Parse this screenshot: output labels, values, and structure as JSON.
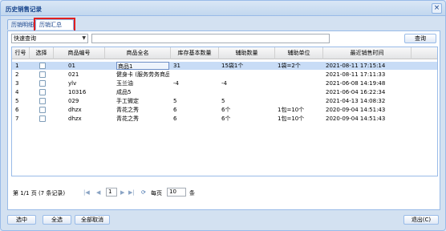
{
  "window": {
    "title": "历史销售记录",
    "close_icon": "close-icon"
  },
  "tabs": [
    {
      "label": "历销明细",
      "active": false
    },
    {
      "label": "历销汇总",
      "active": true
    }
  ],
  "search": {
    "mode": "快速查询",
    "value": "",
    "button": "查询"
  },
  "grid": {
    "columns": [
      "行号",
      "选择",
      "商品编号",
      "商品全名",
      "库存基本数量",
      "辅助数量",
      "辅助单位",
      "最近销售时间"
    ],
    "rows": [
      {
        "no": "1",
        "code": "01",
        "name": "商品1",
        "stock": "31",
        "aux_qty": "15袋1个",
        "aux_unit": "1袋=2个",
        "time": "2021-08-11 17:15:14",
        "selected": true
      },
      {
        "no": "2",
        "code": "021",
        "name": "健身卡 (服务劳务商品)",
        "stock": "",
        "aux_qty": "",
        "aux_unit": "",
        "time": "2021-08-11 17:11:33",
        "selected": false
      },
      {
        "no": "3",
        "code": "ylv",
        "name": "玉兰油",
        "stock": "-4",
        "aux_qty": "-4",
        "aux_unit": "",
        "time": "2021-06-08 14:19:48",
        "selected": false
      },
      {
        "no": "4",
        "code": "10316",
        "name": "成品5",
        "stock": "",
        "aux_qty": "",
        "aux_unit": "",
        "time": "2021-06-04 16:22:34",
        "selected": false
      },
      {
        "no": "5",
        "code": "029",
        "name": "手工微定",
        "stock": "5",
        "aux_qty": "5",
        "aux_unit": "",
        "time": "2021-04-13 14:08:32",
        "selected": false
      },
      {
        "no": "6",
        "code": "dhzx",
        "name": "青花之秀",
        "stock": "6",
        "aux_qty": "6个",
        "aux_unit": "1包=10个",
        "time": "2020-09-04 14:51:43",
        "selected": false
      },
      {
        "no": "7",
        "code": "dhzx",
        "name": "青花之秀",
        "stock": "6",
        "aux_qty": "6个",
        "aux_unit": "1包=10个",
        "time": "2020-09-04 14:51:43",
        "selected": false
      }
    ]
  },
  "pager": {
    "summary": "第 1/1 页 (7 条记录)",
    "current_page": "1",
    "page_size_label": "每页",
    "page_size": "10",
    "page_size_unit": "条"
  },
  "footer": {
    "select": "选中",
    "select_all": "全选",
    "deselect_all": "全部取消",
    "exit": "退出(C)"
  }
}
